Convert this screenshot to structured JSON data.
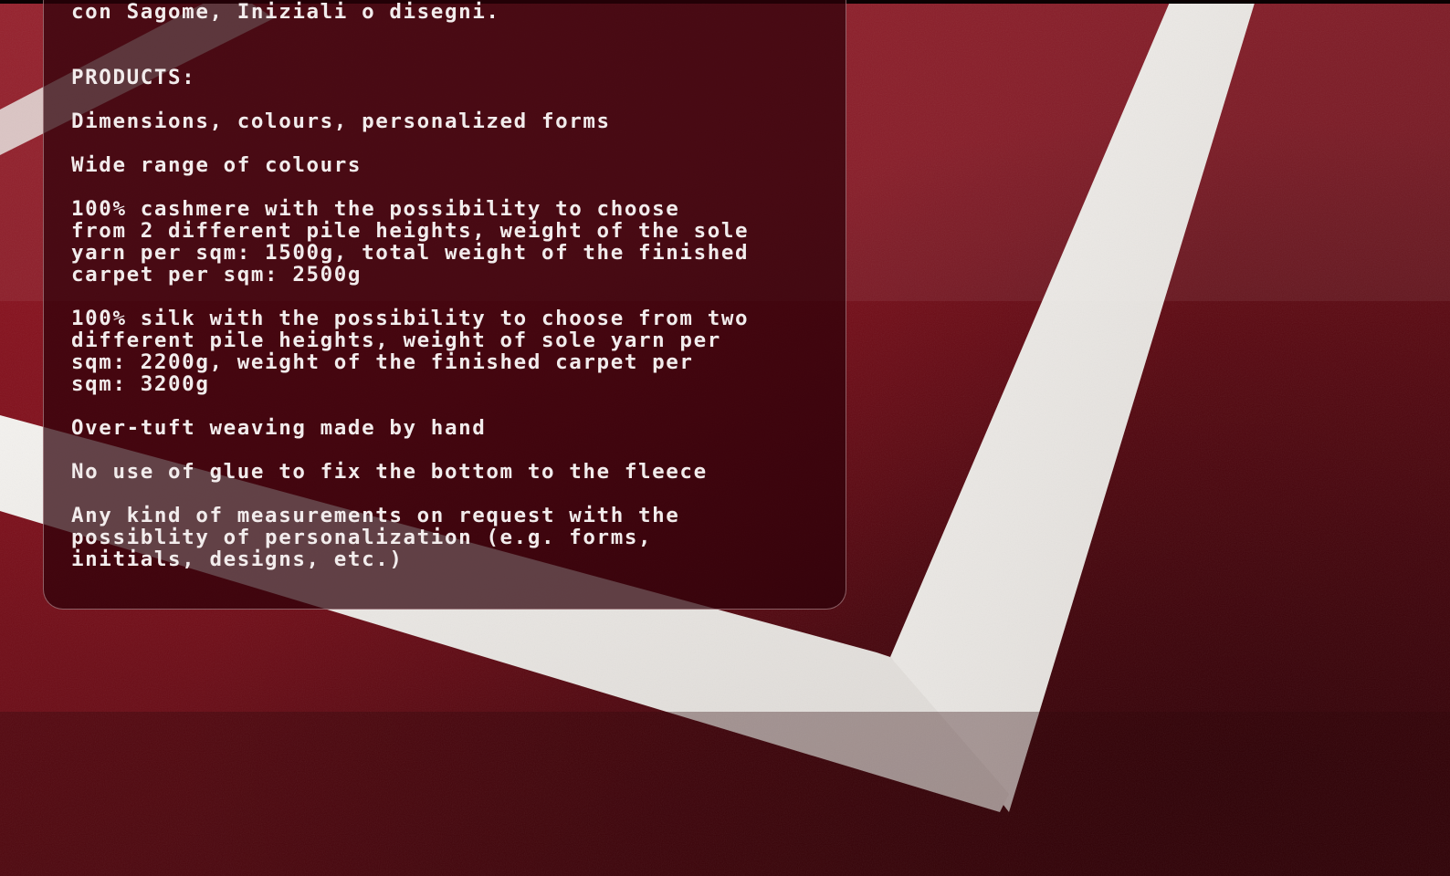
{
  "panel": {
    "intro": "con Sagome, Iniziali o disegni.",
    "heading": "PRODUCTS:",
    "paragraphs": [
      "Dimensions, colours, personalized forms",
      "Wide range of colours",
      "100% cashmere with the possibility to choose\nfrom 2 different pile heights, weight of the sole\nyarn per sqm: 1500g, total weight of the finished\ncarpet per sqm: 2500g",
      "100% silk with the possibility to choose from two\ndifferent pile heights, weight of sole yarn per\nsqm: 2200g, weight of the finished carpet per\nsqm: 3200g",
      "Over-tuft weaving made by hand",
      "No use of glue to fix the bottom to the fleece",
      "Any kind of measurements on request with the\npossiblity of personalization (e.g. forms,\ninitials, designs, etc.)"
    ]
  },
  "colors": {
    "carpet": "#7a0f1a",
    "stripe": "#ece9e6",
    "panel_bg": "#2d0008",
    "text": "#f2ecec"
  }
}
